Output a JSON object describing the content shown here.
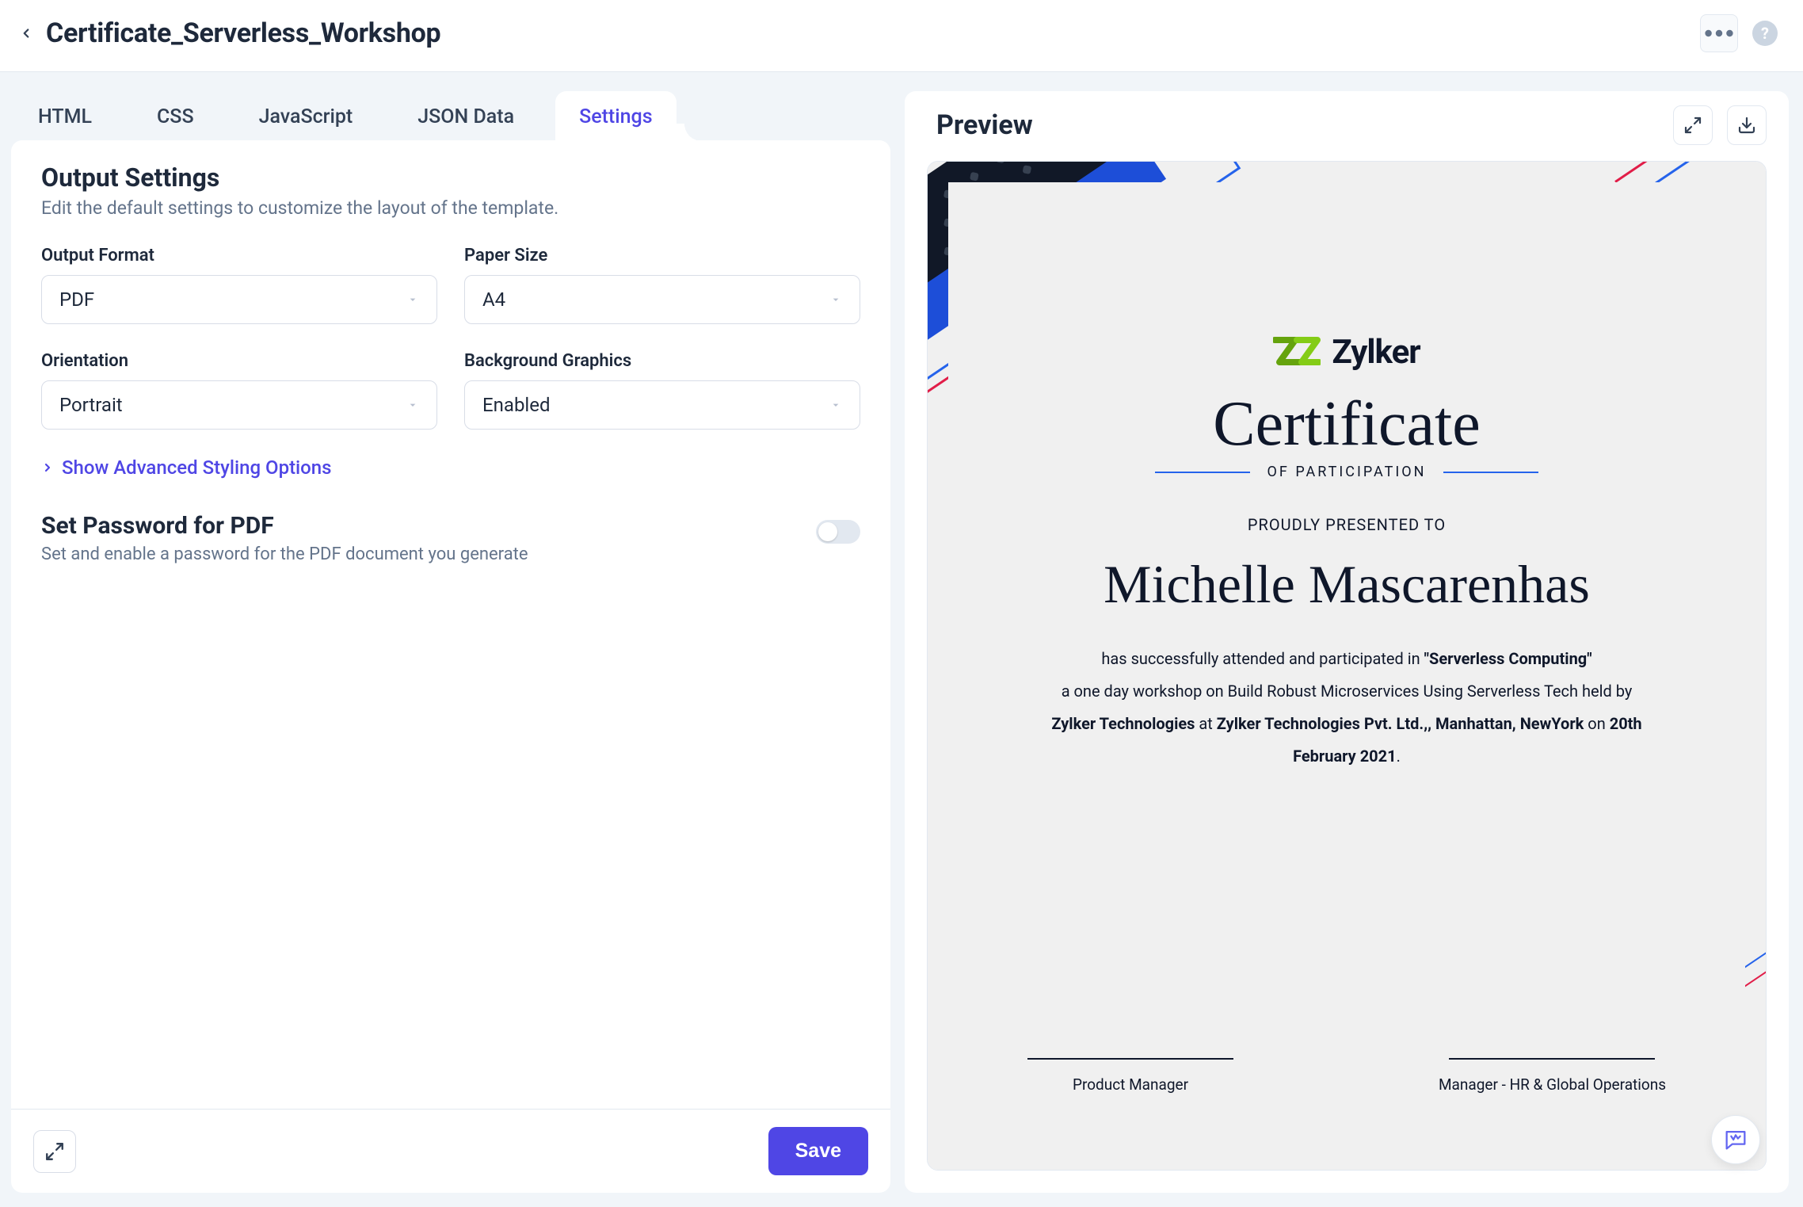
{
  "header": {
    "title": "Certificate_Serverless_Workshop"
  },
  "tabs": [
    {
      "label": "HTML"
    },
    {
      "label": "CSS"
    },
    {
      "label": "JavaScript"
    },
    {
      "label": "JSON Data"
    },
    {
      "label": "Settings",
      "active": true
    }
  ],
  "settings": {
    "title": "Output Settings",
    "description": "Edit the default settings to customize the layout of the template.",
    "fields": {
      "output_format": {
        "label": "Output Format",
        "value": "PDF"
      },
      "paper_size": {
        "label": "Paper Size",
        "value": "A4"
      },
      "orientation": {
        "label": "Orientation",
        "value": "Portrait"
      },
      "background_graphics": {
        "label": "Background Graphics",
        "value": "Enabled"
      }
    },
    "advanced_link": "Show Advanced Styling Options",
    "password_section": {
      "title": "Set Password for PDF",
      "description": "Set and enable a password for the PDF document you generate",
      "enabled": false
    },
    "save_label": "Save"
  },
  "preview": {
    "title": "Preview",
    "certificate": {
      "brand": "Zylker",
      "heading_script": "Certificate",
      "heading_sub": "OF PARTICIPATION",
      "proudly": "PROUDLY PRESENTED TO",
      "recipient": "Michelle Mascarenhas",
      "body_prefix": "has successfully attended and participated in ",
      "body_event_quoted": "\"Serverless Computing\"",
      "body_line2": "a one day workshop on Build Robust Microservices Using Serverless Tech held by ",
      "body_org": "Zylker Technologies",
      "body_at": " at ",
      "body_venue": "Zylker Technologies Pvt. Ltd.,, Manhattan, NewYork",
      "body_on": " on ",
      "body_date": "20th February 2021",
      "body_period": ".",
      "sign_left": "Product Manager",
      "sign_right": "Manager - HR & Global Operations"
    }
  }
}
